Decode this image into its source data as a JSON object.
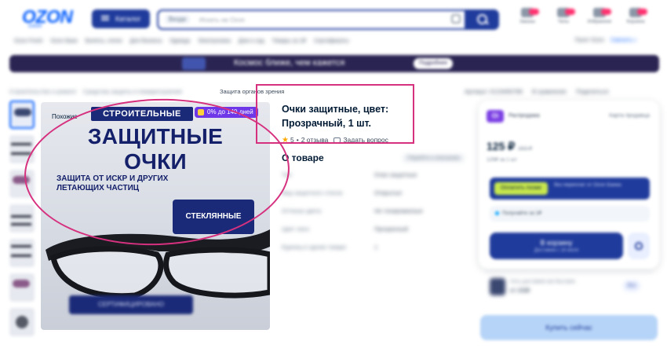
{
  "header": {
    "logo": "OZON",
    "logo_sub": "ОЗОН",
    "catalog_label": "Каталог",
    "search_scope": "Везде",
    "search_placeholder": "Искать на Ozon",
    "icons": [
      {
        "name": "orders-icon",
        "label": "Заказы"
      },
      {
        "name": "messages-icon",
        "label": "Чаты"
      },
      {
        "name": "favorites-icon",
        "label": "Избранное"
      },
      {
        "name": "cart-icon",
        "label": "Корзина"
      }
    ]
  },
  "subnav": {
    "items": [
      "Ozon Fresh",
      "Ozon Банк",
      "Билеты, отели",
      "Для бизнеса",
      "Одежда",
      "Электроника",
      "Дом и сад",
      "Товары за 1₽",
      "Сертификаты"
    ],
    "right_label": "Пункт Ozon",
    "city": "Сменить г."
  },
  "banner": {
    "text": "Космос ближе, чем кажется",
    "button": "Подробнее"
  },
  "breadcrumbs": {
    "items": [
      "Строительство и ремонт",
      "Средства защиты и пожаротушения"
    ],
    "last": "Защита органов зрения"
  },
  "top_actions": [
    "Артикул: 0123456789",
    "В сравнение",
    "Поделиться"
  ],
  "product_image": {
    "similar_label": "Похожие",
    "tag": "СТРОИТЕЛЬНЫЕ",
    "installment": "0% до 140 дней",
    "headline_1": "ЗАЩИТНЫЕ",
    "headline_2": "ОЧКИ",
    "subtext": "ЗАЩИТА ОТ ИСКР И ДРУГИХ ЛЕТАЮЩИХ ЧАСТИЦ",
    "glass_label": "СТЕКЛЯННЫЕ",
    "cert_label": "СЕРТИФИЦИРОВАНО"
  },
  "product": {
    "title": "Очки защитные, цвет: Прозрачный, 1 шт.",
    "rating": "5",
    "reviews": "2 отзыва",
    "ask": "Задать вопрос"
  },
  "about": {
    "heading": "О товаре",
    "link": "Перейти к описанию",
    "specs": [
      {
        "k": "Тип",
        "v": "Очки защитные"
      },
      {
        "k": "Вид защитного стекла",
        "v": "Открытые"
      },
      {
        "k": "Оттенок цвета",
        "v": "Не тонированные"
      },
      {
        "k": "Цвет линз",
        "v": "Прозрачный"
      },
      {
        "k": "Единиц в одном товаре",
        "v": "1"
      }
    ]
  },
  "buy_card": {
    "badge": "Oi",
    "brand": "Распродажа",
    "store": "Карта продавца",
    "price": "125 ₽",
    "price_old": "152 ₽",
    "price_note": "125₽ за 1 шт",
    "promo_button": "Оплатить позже",
    "promo_text": "без переплат\nот Ozon Банка",
    "pickup": "Получайте за 1₽",
    "cart_label": "В корзину",
    "cart_sub": "Доставим с 18 июля",
    "delivery_text": "Хоть доставим как быстрее",
    "delivery_price": "от 150₽",
    "delivery_btn": "Все",
    "buy_now": "Купить сейчас"
  },
  "colors": {
    "brand": "#005bff",
    "primary_dark": "#1f3b9c",
    "annotation": "#d6317f",
    "installment": "#6e38e8"
  }
}
